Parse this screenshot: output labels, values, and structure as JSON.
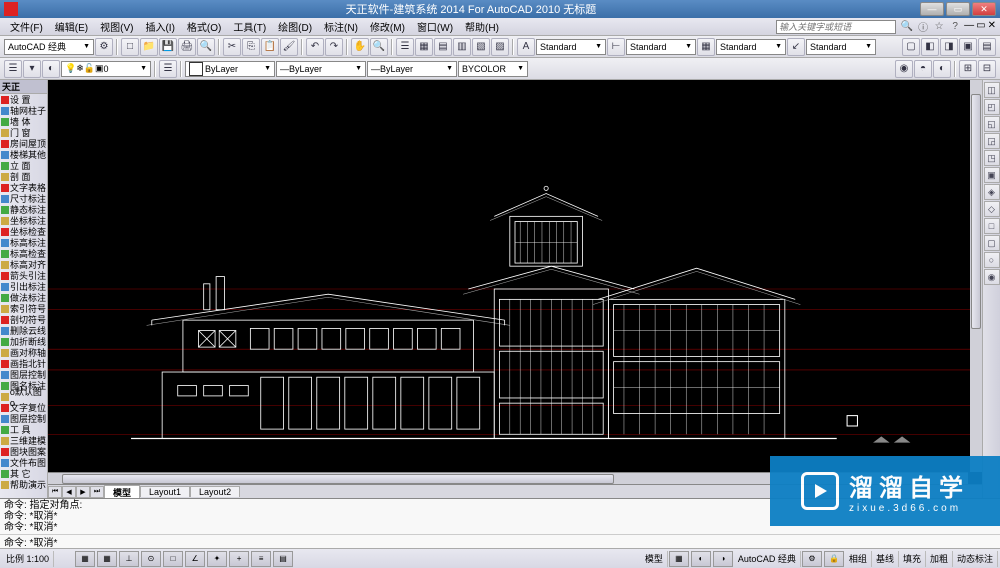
{
  "titlebar": {
    "title": "天正软件-建筑系统 2014  For AutoCAD 2010    无标题"
  },
  "menubar": {
    "items": [
      "文件(F)",
      "编辑(E)",
      "视图(V)",
      "插入(I)",
      "格式(O)",
      "工具(T)",
      "绘图(D)",
      "标注(N)",
      "修改(M)",
      "窗口(W)",
      "帮助(H)"
    ],
    "search_placeholder": "输入关键字或短语"
  },
  "toolbar1": {
    "workspace": "AutoCAD 经典"
  },
  "toolbar2": {
    "layer": "0",
    "std1": "Standard",
    "std2": "Standard",
    "std3": "Standard",
    "std4": "Standard"
  },
  "toolbar3": {
    "color": "ByLayer",
    "linetype": "ByLayer",
    "lineweight": "ByLayer",
    "plotstyle": "BYCOLOR"
  },
  "leftpanel": {
    "header": "天正",
    "items": [
      "设 置",
      "轴网柱子",
      "墙 体",
      "门 窗",
      "房间屋顶",
      "楼梯其他",
      "立 面",
      "剖 面",
      "文字表格",
      "尺寸标注",
      "静态标注",
      "坐标标注",
      "坐标检查",
      "标高标注",
      "标高检查",
      "标高对齐",
      "箭头引注",
      "引出标注",
      "做法标注",
      "索引符号",
      "剖切符号",
      "删除云线",
      "加折断线",
      "画对称轴",
      "画指北针",
      "图层控制",
      "图名标注",
      "o默认图o",
      "文字复位",
      "图层控制",
      "工 具",
      "三维建模",
      "图块图案",
      "文件布图",
      "其 它",
      "帮助演示"
    ]
  },
  "drawing_tabs": {
    "tabs": [
      "模型",
      "Layout1",
      "Layout2"
    ]
  },
  "command": {
    "history": [
      "命令: 指定对角点:",
      "命令: *取消*",
      "命令: *取消*"
    ],
    "prompt": "命令: *取消*"
  },
  "statusbar": {
    "scale": "比例 1:100",
    "right_label": "AutoCAD 经典",
    "toggles": [
      "捕捉",
      "栅格",
      "正交",
      "极轴",
      "对象捕",
      "对象追",
      "DUCS",
      "DYN",
      "线宽",
      "QP"
    ],
    "right_toggles": [
      "相组",
      "基线",
      "填充",
      "加粗",
      "动态标注"
    ]
  },
  "watermark": {
    "main": "溜溜自学",
    "sub": "zixue.3d66.com"
  }
}
